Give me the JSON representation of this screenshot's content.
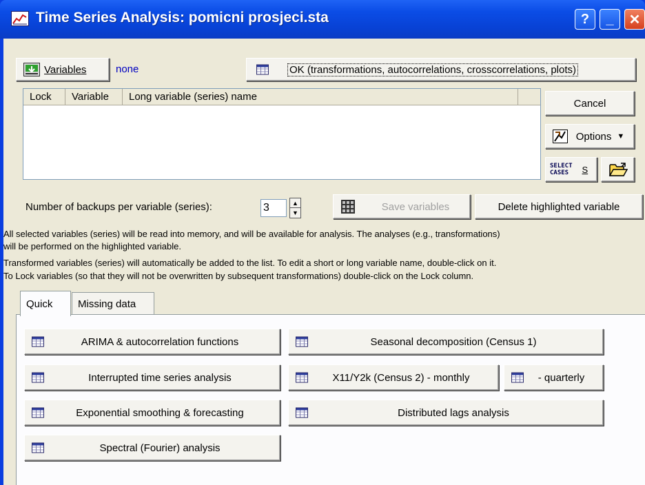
{
  "window": {
    "title": "Time Series Analysis: pomicni prosjeci.sta",
    "help_label": "?",
    "minimize_label": "_",
    "close_label": "✕"
  },
  "toolbar": {
    "variables_label": "Variables",
    "variables_value": "none",
    "ok_label": "OK (transformations, autocorrelations, crosscorrelations, plots)",
    "cancel_label": "Cancel",
    "options_label": "Options",
    "select_cases_line1": "SELECT",
    "select_cases_line2": "CASES",
    "select_cases_s": "S"
  },
  "variable_list": {
    "columns": [
      "Lock",
      "Variable",
      "Long variable (series) name"
    ]
  },
  "backups": {
    "label": "Number of backups per variable (series):",
    "value": "3"
  },
  "actions": {
    "save_variables": "Save variables",
    "delete_highlighted": "Delete highlighted variable"
  },
  "info": {
    "line1": "All selected variables (series) will be read into memory, and will be available for analysis. The analyses (e.g., transformations)",
    "line2": "will be performed on the highlighted variable.",
    "line3": "Transformed variables (series) will automatically be added to the list. To edit a short or long variable name, double-click on it.",
    "line4": "To Lock variables (so that they will not be overwritten by subsequent transformations) double-click on the Lock column."
  },
  "tabs": [
    {
      "label": "Quick",
      "active": true
    },
    {
      "label": "Missing data",
      "active": false
    }
  ],
  "analyses": {
    "arima": "ARIMA & autocorrelation functions",
    "interrupted": "Interrupted time series analysis",
    "exponential": "Exponential smoothing & forecasting",
    "spectral": "Spectral (Fourier) analysis",
    "seasonal": "Seasonal decomposition (Census 1)",
    "x11_monthly": "X11/Y2k (Census 2) - monthly",
    "quarterly": "- quarterly",
    "distributed": "Distributed lags analysis"
  }
}
